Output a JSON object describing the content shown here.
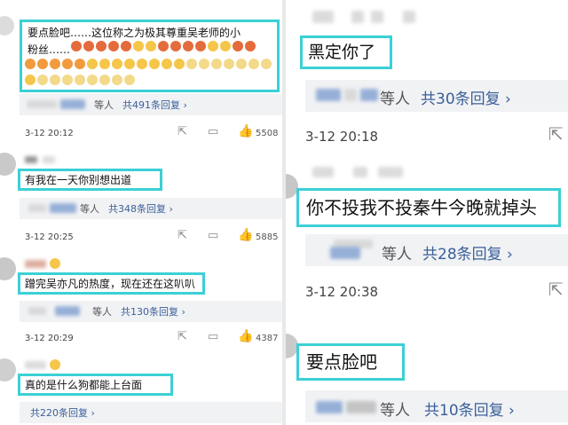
{
  "left_panel": {
    "comment1": {
      "text_line1": "要点脸吧……这位称之为极其尊重吴老师的小",
      "text_line2": "粉丝……",
      "reply_summary": "等人",
      "reply_count": "共491条回复 ›",
      "time": "3-12 20:12",
      "likes": "5508"
    },
    "comment2": {
      "text": "有我在一天你别想出道",
      "reply_summary": "等人",
      "reply_count": "共348条回复 ›",
      "time": "3-12 20:25",
      "likes": "5885"
    },
    "comment3": {
      "text": "蹭完吴亦凡的热度，现在还在这叭叭",
      "reply_summary": "等人",
      "reply_count": "共130条回复 ›",
      "time": "3-12 20:29",
      "likes": "4387"
    },
    "comment4": {
      "text": "真的是什么狗都能上台面",
      "reply_count": "共220条回复 ›"
    }
  },
  "right_panel": {
    "comment1": {
      "text": "黑定你了",
      "reply_summary": "等人",
      "reply_count": "共30条回复 ›",
      "time": "3-12 20:18"
    },
    "comment2": {
      "text": "你不投我不投秦牛今晚就掉头",
      "reply_summary": "等人",
      "reply_count": "共28条回复 ›",
      "time": "3-12 20:38"
    },
    "comment3": {
      "text": "要点脸吧",
      "reply_summary": "等人",
      "reply_count": "共10条回复 ›"
    }
  },
  "icons": {
    "share": "share-icon",
    "comment": "comment-icon",
    "like": "thumbs-up-icon"
  },
  "colors": {
    "highlight_border": "#3cd0d6",
    "reply_link": "#3a5f99",
    "reply_background": "#f1f2f4"
  }
}
